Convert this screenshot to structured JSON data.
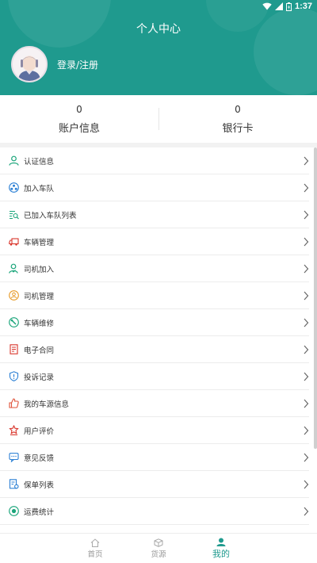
{
  "status_bar": {
    "time": "1:37"
  },
  "header": {
    "title": "个人中心",
    "login_label": "登录/注册"
  },
  "stats": [
    {
      "value": "0",
      "label": "账户信息"
    },
    {
      "value": "0",
      "label": "银行卡"
    }
  ],
  "menu": [
    {
      "label": "认证信息",
      "icon": "user-verify-icon",
      "color": "#1aa57a"
    },
    {
      "label": "加入车队",
      "icon": "team-icon",
      "color": "#2a7fd4"
    },
    {
      "label": "已加入车队列表",
      "icon": "list-search-icon",
      "color": "#1aa57a"
    },
    {
      "label": "车辆管理",
      "icon": "truck-icon",
      "color": "#d9352b"
    },
    {
      "label": "司机加入",
      "icon": "driver-add-icon",
      "color": "#1aa57a"
    },
    {
      "label": "司机管理",
      "icon": "driver-manage-icon",
      "color": "#e79a27"
    },
    {
      "label": "车辆维修",
      "icon": "wrench-icon",
      "color": "#1aa57a"
    },
    {
      "label": "电子合同",
      "icon": "contract-icon",
      "color": "#d9352b"
    },
    {
      "label": "投诉记录",
      "icon": "shield-icon",
      "color": "#2a7fd4"
    },
    {
      "label": "我的车源信息",
      "icon": "thumb-icon",
      "color": "#e0533a"
    },
    {
      "label": "用户评价",
      "icon": "rating-icon",
      "color": "#d9352b"
    },
    {
      "label": "意见反馈",
      "icon": "feedback-icon",
      "color": "#2a7fd4"
    },
    {
      "label": "保单列表",
      "icon": "policy-icon",
      "color": "#2a7fd4"
    },
    {
      "label": "运费统计",
      "icon": "stats-icon",
      "color": "#1aa57a"
    }
  ],
  "bottom_nav": [
    {
      "label": "首页",
      "icon": "home-icon"
    },
    {
      "label": "货源",
      "icon": "cube-icon"
    },
    {
      "label": "我的",
      "icon": "profile-icon",
      "active": true
    }
  ],
  "colors": {
    "primary": "#1f9a8e"
  }
}
